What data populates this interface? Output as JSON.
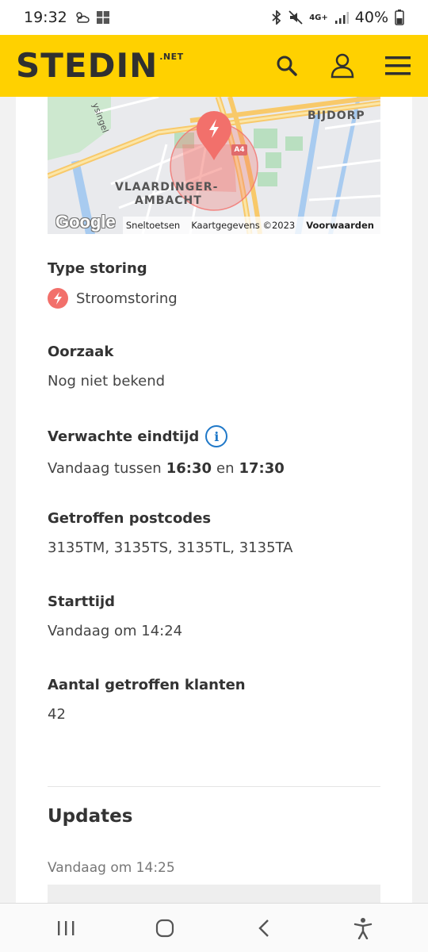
{
  "status_bar": {
    "time": "19:32",
    "network": "4G+",
    "battery": "40%",
    "icons": [
      "weather-icon",
      "gallery-icon",
      "bluetooth-icon",
      "mute-icon",
      "signal-icon",
      "battery-icon"
    ]
  },
  "header": {
    "logo_text": "STEDIN",
    "logo_suffix": ".NET",
    "brand_color": "#ffd100",
    "icons": [
      "search-icon",
      "user-icon",
      "menu-icon"
    ]
  },
  "map": {
    "labels": {
      "area": "VLAARDINGER-",
      "area2": "AMBACHT",
      "bijdorp": "BIJDORP",
      "road": "A4",
      "street": "ysingel"
    },
    "google": "Google",
    "footer": {
      "shortcuts": "Sneltoetsen",
      "mapdata": "Kaartgegevens ©2023",
      "terms": "Voorwaarden"
    },
    "marker_color": "#f2706b"
  },
  "details": {
    "type_label": "Type storing",
    "type_value": "Stroomstoring",
    "cause_label": "Oorzaak",
    "cause_value": "Nog niet bekend",
    "end_label": "Verwachte eindtijd",
    "end_prefix": "Vandaag tussen",
    "end_from": "16:30",
    "end_mid": "en",
    "end_to": "17:30",
    "postcodes_label": "Getroffen postcodes",
    "postcodes_value": "3135TM, 3135TS, 3135TL, 3135TA",
    "start_label": "Starttijd",
    "start_value": "Vandaag om 14:24",
    "customers_label": "Aantal getroffen klanten",
    "customers_value": "42"
  },
  "updates": {
    "title": "Updates",
    "first_time": "Vandaag om 14:25"
  },
  "navbar": {
    "icons": [
      "recents-icon",
      "home-icon",
      "back-icon",
      "accessibility-icon"
    ]
  }
}
